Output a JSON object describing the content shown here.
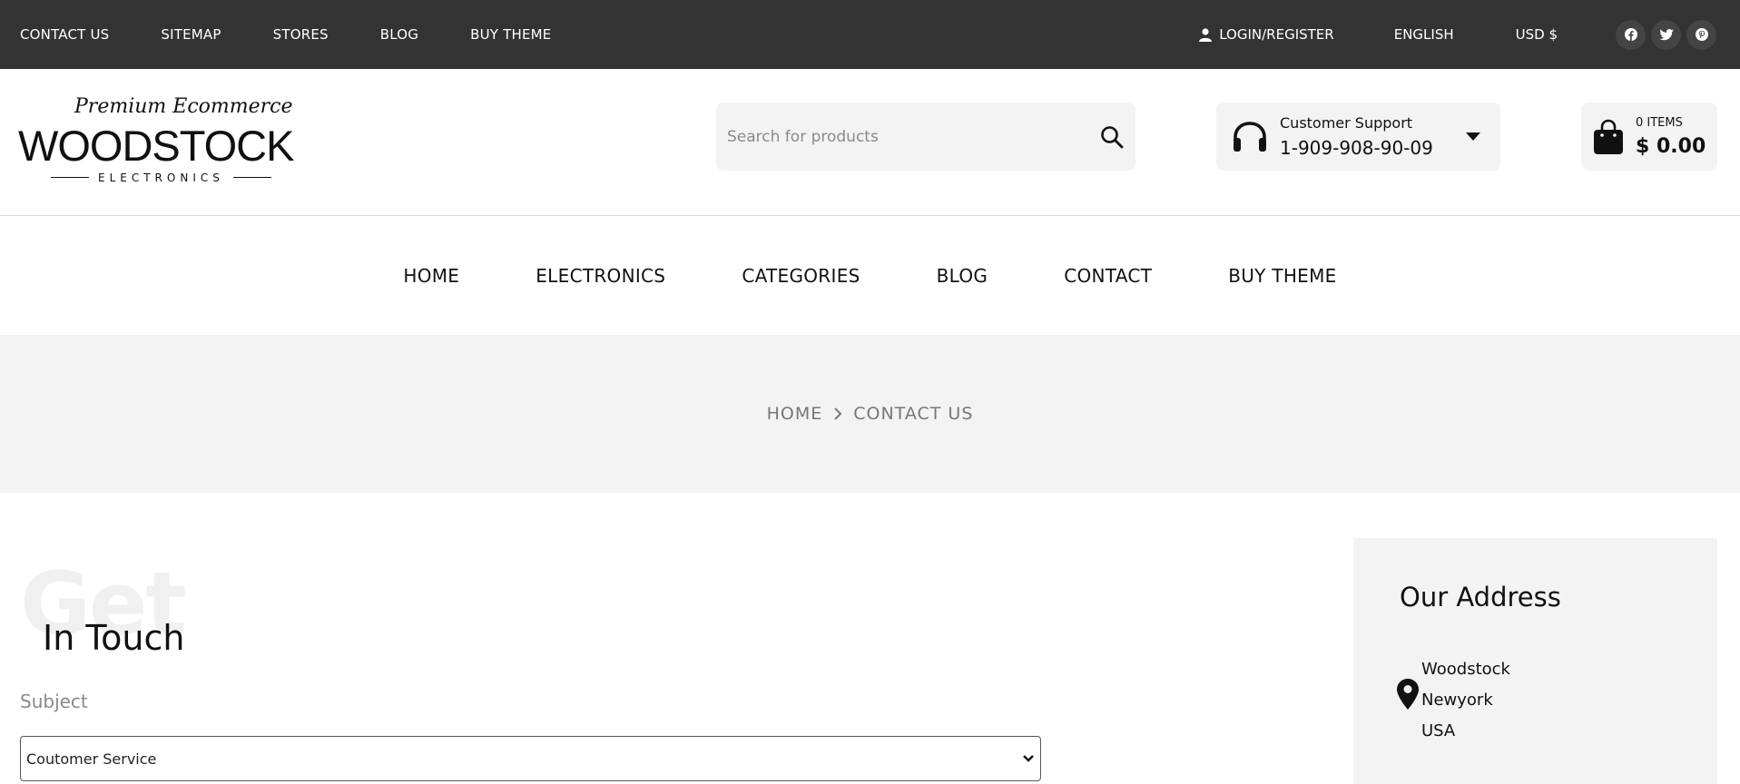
{
  "topbar": {
    "links": [
      "CONTACT US",
      "SITEMAP",
      "STORES",
      "BLOG",
      "BUY THEME"
    ],
    "login": "LOGIN/REGISTER",
    "language": "ENGLISH",
    "currency": "USD $",
    "social_icons": [
      "facebook-icon",
      "twitter-icon",
      "pinterest-icon"
    ]
  },
  "logo": {
    "tagline": "Premium Ecommerce",
    "brand": "WOODSTOCK",
    "sub": "ELECTRONICS"
  },
  "search": {
    "placeholder": "Search for products"
  },
  "support": {
    "label": "Customer Support",
    "phone": "1-909-908-90-09"
  },
  "cart": {
    "items": "0 ITEMS",
    "total": "$ 0.00"
  },
  "nav": [
    "HOME",
    "ELECTRONICS",
    "CATEGORIES",
    "BLOG",
    "CONTACT",
    "BUY THEME"
  ],
  "breadcrumb": {
    "home": "HOME",
    "current": "CONTACT US"
  },
  "main": {
    "ghost": "Get",
    "heading": "In Touch",
    "subject_label": "Subject",
    "subject_value": "Coutomer Service"
  },
  "address": {
    "title": "Our Address",
    "lines": [
      "Woodstock",
      "Newyork",
      "USA"
    ]
  },
  "colors": {
    "topbar": "#333333",
    "panel": "#f3f3f3",
    "text": "#111111",
    "muted": "#777777"
  }
}
